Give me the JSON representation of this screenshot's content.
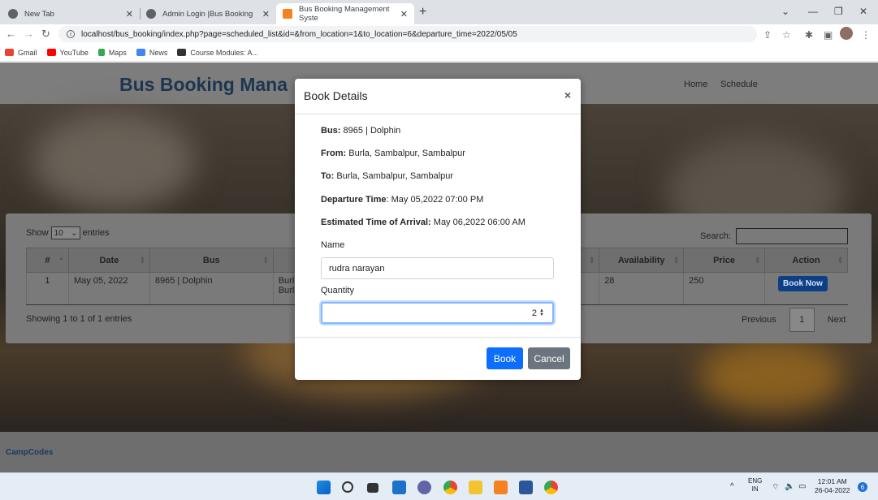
{
  "browser": {
    "tabs": [
      {
        "label": "New Tab"
      },
      {
        "label": "Admin Login |Bus Booking"
      },
      {
        "label": "Bus Booking Management Syste"
      }
    ],
    "url": "localhost/bus_booking/index.php?page=scheduled_list&id=&from_location=1&to_location=6&departure_time=2022/05/05",
    "bookmarks": [
      "Gmail",
      "YouTube",
      "Maps",
      "News",
      "Course Modules: A..."
    ]
  },
  "site": {
    "brand": "Bus Booking Mana",
    "nav": [
      "Home",
      "Schedule"
    ],
    "footer": "CampCodes"
  },
  "table": {
    "show_label": "Show",
    "entries_value": "10",
    "entries_label": "entries",
    "search_label": "Search:",
    "headers": [
      "#",
      "Date",
      "Bus",
      "Availability",
      "Price",
      "Action"
    ],
    "row": {
      "num": "1",
      "date": "May 05, 2022",
      "bus": "8965 | Dolphin",
      "route_l1": "Burl",
      "route_l2": "Burl",
      "availability": "28",
      "price": "250",
      "action": "Book Now"
    },
    "info": "Showing 1 to 1 of 1 entries",
    "pager": {
      "previous": "Previous",
      "current": "1",
      "next": "Next"
    }
  },
  "modal": {
    "title": "Book Details",
    "close": "×",
    "bus_label": "Bus:",
    "bus_value": "8965 | Dolphin",
    "from_label": "From:",
    "from_value": "Burla, Sambalpur, Sambalpur",
    "to_label": "To:",
    "to_value": "Burla, Sambalpur, Sambalpur",
    "departure_label": "Departure Time",
    "departure_value": ": May 05,2022 07:00 PM",
    "eta_label": "Estimated Time of Arrival:",
    "eta_value": "May 06,2022 06:00 AM",
    "name_label": "Name",
    "name_value": "rudra narayan",
    "quantity_label": "Quantity",
    "quantity_value": "2",
    "book_label": "Book",
    "cancel_label": "Cancel"
  },
  "taskbar": {
    "lang_l1": "ENG",
    "lang_l2": "IN",
    "time": "12:01 AM",
    "date": "26-04-2022",
    "notifications": "6"
  },
  "colors": {
    "primary": "#0d6efd",
    "secondary": "#6c757d",
    "brand": "#1e3550"
  }
}
